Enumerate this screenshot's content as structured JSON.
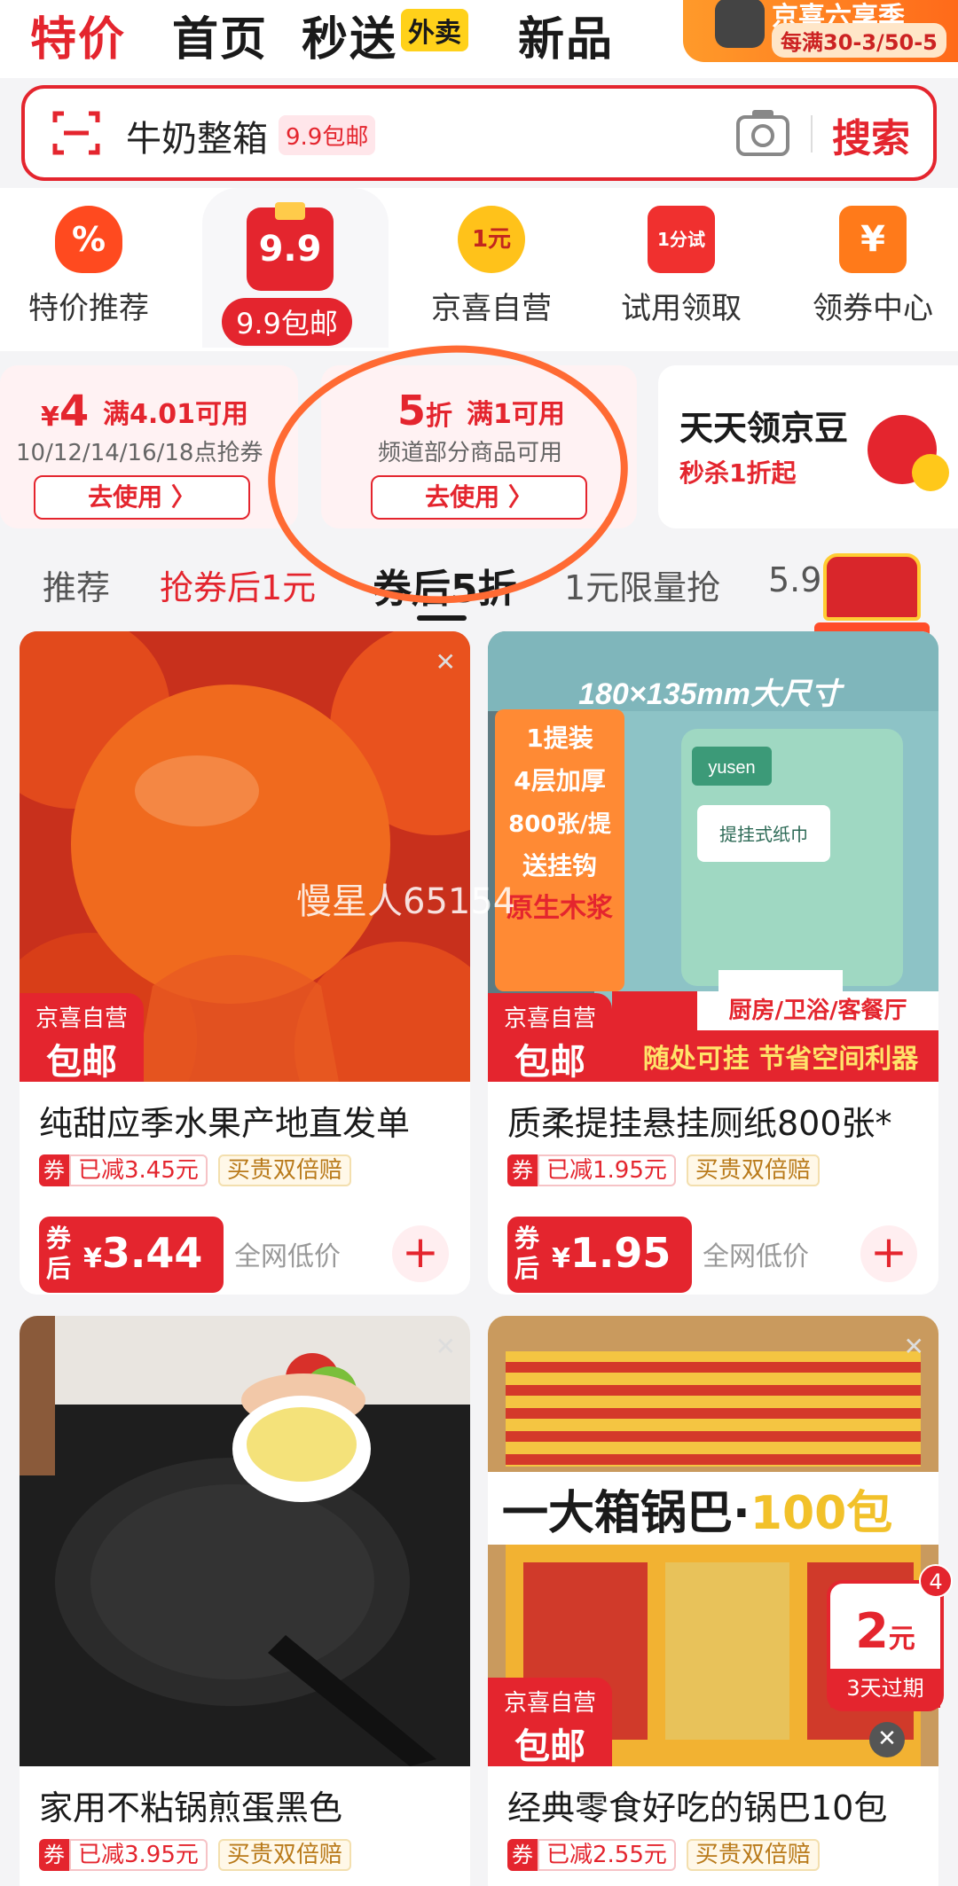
{
  "topnav": {
    "tabs": [
      "特价",
      "首页",
      "秒送",
      "新品"
    ],
    "waimai_tag": "外卖",
    "promo_line1": "京喜六享季",
    "promo_line2": "每满30-3/50-5"
  },
  "search": {
    "query": "牛奶整箱",
    "query_badge": "9.9包邮",
    "button": "搜索"
  },
  "categories": [
    {
      "label": "特价推荐",
      "icon": "percent-fire-icon"
    },
    {
      "label": "9.9包邮",
      "icon": "nine-nine-gift-icon",
      "icon_text": "9.9"
    },
    {
      "label": "京喜自营",
      "icon": "one-yuan-badge-icon",
      "icon_text": "1元"
    },
    {
      "label": "试用领取",
      "icon": "trial-bag-icon",
      "icon_text": "1分试"
    },
    {
      "label": "领券中心",
      "icon": "coupon-wallet-icon",
      "icon_text": "¥"
    }
  ],
  "coupons": [
    {
      "currency": "¥",
      "amount": "4",
      "condition": "满4.01可用",
      "sub": "10/12/14/16/18点抢券",
      "button": "去使用 〉"
    },
    {
      "amount": "5",
      "unit": "折",
      "condition": "满1可用",
      "sub": "频道部分商品可用",
      "button": "去使用 〉"
    }
  ],
  "jd_beans": {
    "title": "天天领京豆",
    "subtitle": "秒杀1折起"
  },
  "filters": [
    "推荐",
    "抢券后1元",
    "券后5折",
    "1元限量抢",
    "5.9"
  ],
  "watermark": "慢星人65154",
  "products": [
    {
      "title": "纯甜应季水果产地直发单",
      "discount": "已减3.45元",
      "double": "买贵双倍赔",
      "price": "3.44",
      "badge1": "京喜自营",
      "badge2": "包邮",
      "lowest": "全网低价",
      "quan": "券",
      "qh": "券后"
    },
    {
      "title": "质柔提挂悬挂厕纸800张*",
      "discount": "已减1.95元",
      "double": "买贵双倍赔",
      "price": "1.95",
      "badge1": "京喜自营",
      "badge2": "包邮",
      "lowest": "全网低价",
      "quan": "券",
      "qh": "券后",
      "img_text": {
        "top": "180×135mm大尺寸",
        "points": [
          "1提装",
          "4层加厚",
          "800张/提",
          "送挂钩",
          "原生木浆"
        ],
        "rooms": "厨房/卫浴/客餐厅",
        "slogan": "随处可挂 节省空间利器",
        "brand": "yusen",
        "pack": "提挂式纸巾"
      }
    },
    {
      "title": "家用不粘锅煎蛋黑色",
      "discount": "已减3.95元",
      "double": "买贵双倍赔",
      "quan": "券"
    },
    {
      "title": "经典零食好吃的锅巴10包",
      "discount": "已减2.55元",
      "double": "买贵双倍赔",
      "badge1": "京喜自营",
      "badge2": "包邮",
      "quan": "券",
      "img_text": {
        "headline": "一大箱锅巴·",
        "highlight": "100包"
      }
    }
  ],
  "float_coupon": {
    "amount": "2",
    "unit": "元",
    "expiry": "3天过期",
    "count": "4"
  },
  "colors": {
    "brand_red": "#e4252e",
    "highlight_orange": "#ff6a33"
  }
}
